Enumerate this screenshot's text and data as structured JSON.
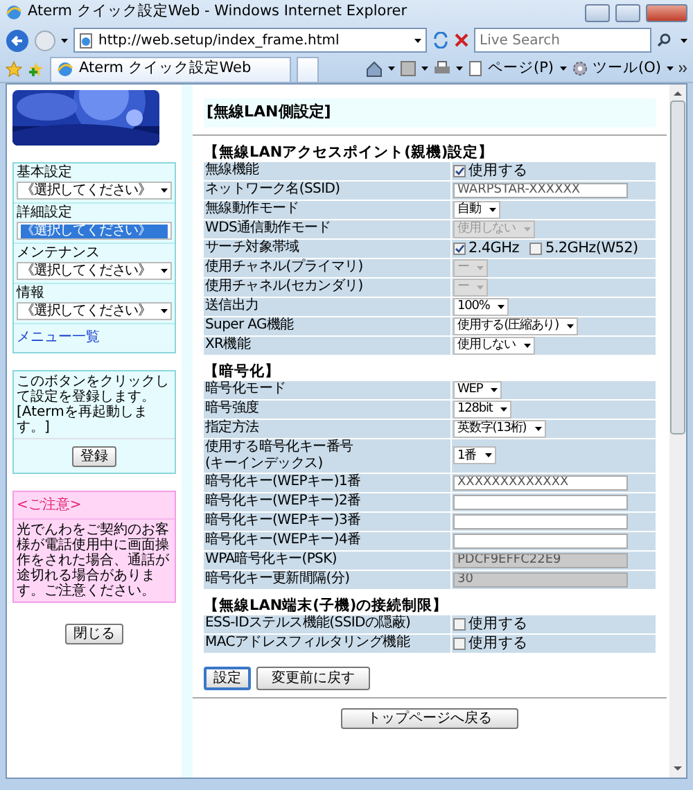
{
  "window": {
    "title": "Aterm クイック設定Web - Windows Internet Explorer"
  },
  "address_bar": {
    "url": "http://web.setup/index_frame.html",
    "search_placeholder": "Live Search"
  },
  "toolbar": {
    "tab_title": "Aterm クイック設定Web",
    "page_menu": "ページ(P)",
    "tools_menu": "ツール(O)"
  },
  "sidebar": {
    "menus": [
      {
        "label": "基本設定",
        "value": "《選択してください》",
        "selected": false
      },
      {
        "label": "詳細設定",
        "value": "《選択してください》",
        "selected": true
      },
      {
        "label": "メンテナンス",
        "value": "《選択してください》",
        "selected": false
      },
      {
        "label": "情報",
        "value": "《選択してください》",
        "selected": false
      }
    ],
    "menu_link": "メニュー一覧",
    "register_note": "このボタンをクリックして設定を登録します。[Atermを再起動します。]",
    "register_button": "登録",
    "caution_title": "<ご注意>",
    "caution_text": "光でんわをご契約のお客様が電話使用中に画面操作をされた場合、通話が途切れる場合があります。ご注意ください。",
    "close_button": "閉じる"
  },
  "main": {
    "heading": "[無線LAN側設定]",
    "sections": [
      {
        "title": "【無線LANアクセスポイント(親機)設定】",
        "rows": [
          {
            "label": "無線機能",
            "kind": "checks",
            "options": [
              {
                "text": "使用する",
                "checked": true
              }
            ]
          },
          {
            "label": "ネットワーク名(SSID)",
            "kind": "text",
            "value": "WARPSTAR-XXXXXX",
            "disabled": false
          },
          {
            "label": "無線動作モード",
            "kind": "select",
            "value": "自動",
            "disabled": false
          },
          {
            "label": "WDS通信動作モード",
            "kind": "select",
            "value": "使用しない",
            "disabled": true
          },
          {
            "label": "サーチ対象帯域",
            "kind": "checks",
            "options": [
              {
                "text": "2.4GHz",
                "checked": true
              },
              {
                "text": "5.2GHz(W52)",
                "checked": false
              }
            ]
          },
          {
            "label": "使用チャネル(プライマリ)",
            "kind": "select",
            "value": "ー",
            "disabled": true
          },
          {
            "label": "使用チャネル(セカンダリ)",
            "kind": "select",
            "value": "ー",
            "disabled": true
          },
          {
            "label": "送信出力",
            "kind": "select",
            "value": "100%",
            "disabled": false
          },
          {
            "label": "Super AG機能",
            "kind": "select",
            "value": "使用する(圧縮あり)",
            "disabled": false
          },
          {
            "label": "XR機能",
            "kind": "select",
            "value": "使用しない",
            "disabled": false
          }
        ]
      },
      {
        "title": "【暗号化】",
        "rows": [
          {
            "label": "暗号化モード",
            "kind": "select",
            "value": "WEP",
            "disabled": false
          },
          {
            "label": "暗号強度",
            "kind": "select",
            "value": "128bit",
            "disabled": false
          },
          {
            "label": "指定方法",
            "kind": "select",
            "value": "英数字(13桁)",
            "disabled": false
          },
          {
            "label": "使用する暗号化キー番号\n(キーインデックス)",
            "kind": "select",
            "value": "1番",
            "disabled": false
          },
          {
            "label": "暗号化キー(WEPキー)1番",
            "kind": "text",
            "value": "XXXXXXXXXXXXX",
            "disabled": false
          },
          {
            "label": "暗号化キー(WEPキー)2番",
            "kind": "text",
            "value": "",
            "disabled": false
          },
          {
            "label": "暗号化キー(WEPキー)3番",
            "kind": "text",
            "value": "",
            "disabled": false
          },
          {
            "label": "暗号化キー(WEPキー)4番",
            "kind": "text",
            "value": "",
            "disabled": false
          },
          {
            "label": "WPA暗号化キー(PSK)",
            "kind": "text",
            "value": "PDCF9EFFC22E9",
            "disabled": true
          },
          {
            "label": "暗号化キー更新間隔(分)",
            "kind": "text",
            "value": "30",
            "disabled": true
          }
        ]
      },
      {
        "title": "【無線LAN端末(子機)の接続制限】",
        "rows": [
          {
            "label": "ESS-IDステルス機能(SSIDの隠蔽)",
            "kind": "checks",
            "options": [
              {
                "text": "使用する",
                "checked": false
              }
            ]
          },
          {
            "label": "MACアドレスフィルタリング機能",
            "kind": "checks",
            "options": [
              {
                "text": "使用する",
                "checked": false
              }
            ]
          }
        ]
      }
    ],
    "buttons": [
      {
        "label": "設定",
        "focused": true
      },
      {
        "label": "変更前に戻す",
        "focused": false
      }
    ],
    "top_button": "トップページへ戻る"
  }
}
